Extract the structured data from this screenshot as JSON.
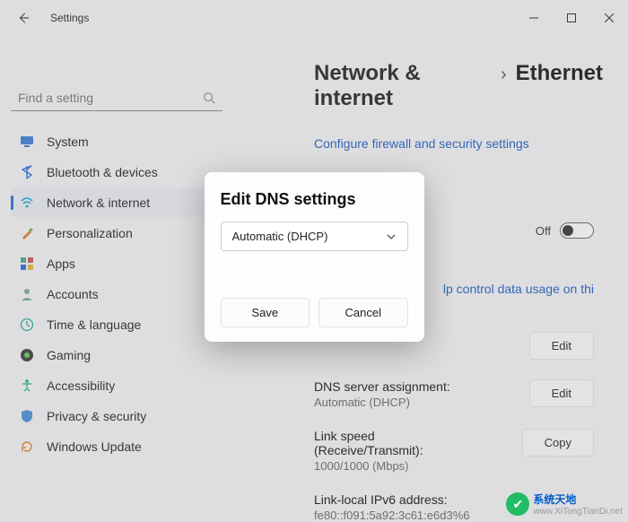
{
  "titlebar": {
    "title": "Settings"
  },
  "sidebar": {
    "search_placeholder": "Find a setting",
    "items": [
      {
        "label": "System",
        "icon": "monitor"
      },
      {
        "label": "Bluetooth & devices",
        "icon": "bluetooth"
      },
      {
        "label": "Network & internet",
        "icon": "wifi",
        "active": true
      },
      {
        "label": "Personalization",
        "icon": "brush"
      },
      {
        "label": "Apps",
        "icon": "apps"
      },
      {
        "label": "Accounts",
        "icon": "user"
      },
      {
        "label": "Time & language",
        "icon": "clock"
      },
      {
        "label": "Gaming",
        "icon": "gaming"
      },
      {
        "label": "Accessibility",
        "icon": "accessibility"
      },
      {
        "label": "Privacy & security",
        "icon": "shield"
      },
      {
        "label": "Windows Update",
        "icon": "update"
      }
    ]
  },
  "main": {
    "breadcrumb_parent": "Network & internet",
    "breadcrumb_sep": "›",
    "breadcrumb_current": "Ethernet",
    "configure_link": "Configure firewall and security settings",
    "toggle_label": "Off",
    "data_usage_link": "lp control data usage on thi",
    "edit_button": "Edit",
    "copy_button": "Copy",
    "rows": [
      {
        "label": "",
        "value": "",
        "button": "Edit"
      },
      {
        "label": "DNS server assignment:",
        "value": "Automatic (DHCP)",
        "button": "Edit"
      },
      {
        "label": "Link speed (Receive/Transmit):",
        "value": "1000/1000 (Mbps)",
        "button": "Copy"
      },
      {
        "label": "Link-local IPv6 address:",
        "value": "fe80::f091:5a92:3c61:e6d3%6",
        "button": ""
      }
    ]
  },
  "dialog": {
    "title": "Edit DNS settings",
    "select_value": "Automatic (DHCP)",
    "save": "Save",
    "cancel": "Cancel"
  },
  "watermark": {
    "cn": "系统天地",
    "url": "www.XiTongTianDi.net"
  }
}
